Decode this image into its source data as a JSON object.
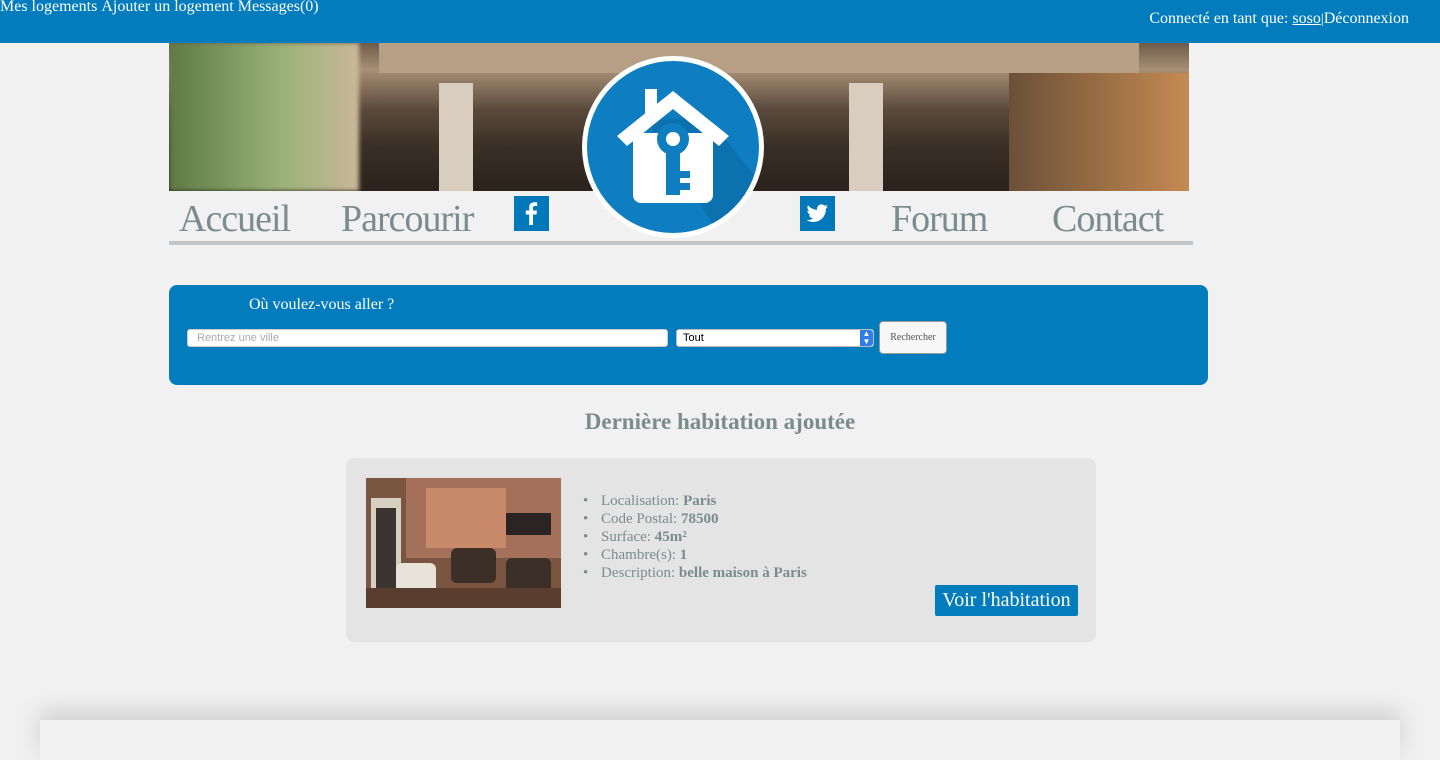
{
  "topbar": {
    "links": [
      "Mes logements",
      "Ajouter un logement",
      "Messages(0)"
    ],
    "connected_label": "Connecté en tant que:",
    "username": "soso",
    "separator": "|",
    "logout": "Déconnexion"
  },
  "nav": {
    "home": "Accueil",
    "browse": "Parcourir",
    "forum": "Forum",
    "contact": "Contact"
  },
  "search": {
    "label": "Où voulez-vous aller ?",
    "city_placeholder": "Rentrez une ville",
    "type_selected": "Tout",
    "button": "Rechercher"
  },
  "latest": {
    "title": "Dernière habitation ajoutée",
    "fields": [
      {
        "label": "Localisation:",
        "value": "Paris"
      },
      {
        "label": "Code Postal:",
        "value": "78500"
      },
      {
        "label": "Surface:",
        "value": "45m²"
      },
      {
        "label": "Chambre(s):",
        "value": "1"
      },
      {
        "label": "Description:",
        "value": "belle maison à Paris"
      }
    ],
    "button": "Voir l'habitation"
  },
  "colors": {
    "brand_blue": "#027cbd",
    "nav_text": "#7a8c8c",
    "background": "#f1f1f1"
  }
}
